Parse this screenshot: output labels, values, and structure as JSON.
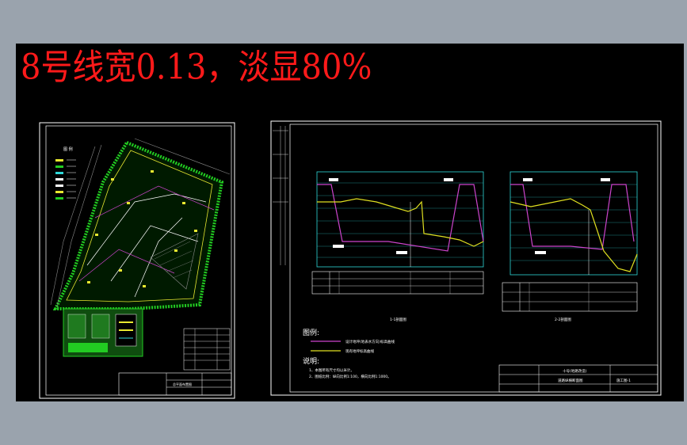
{
  "banner": {
    "text": "8号线宽0.13，淡显80%",
    "color": "#ff1a1a"
  },
  "left_sheet": {
    "legend_title": "图 例",
    "title_block_label": "总平面布置图"
  },
  "right_sheet": {
    "section_title_1": "1-1剖面图",
    "section_title_2": "2-2剖面图",
    "legend_heading": "图例:",
    "legend_items": [
      {
        "label": "设计地坪(地表水方向)标高曲线",
        "color": "#cc44cc"
      },
      {
        "label": "现有地坪标高曲线",
        "color": "#e0e020"
      }
    ],
    "notes_heading": "说明:",
    "notes": [
      "1、本图所有尺寸均以米计。",
      "2、图纸比例：纵向比例1:100，横向比例1:1000。"
    ],
    "title_block_project": "十号(地路改造)",
    "title_block_drawing": "道路纵横断面图",
    "title_block_number": "施工图-1"
  },
  "colors": {
    "canvas": "#000000",
    "frame": "#ffffff",
    "grid": "#2fd8d8",
    "design_curve": "#cc44cc",
    "existing_curve": "#e0e020",
    "site_green": "#22cc22",
    "label_yellow": "#e8e830"
  }
}
